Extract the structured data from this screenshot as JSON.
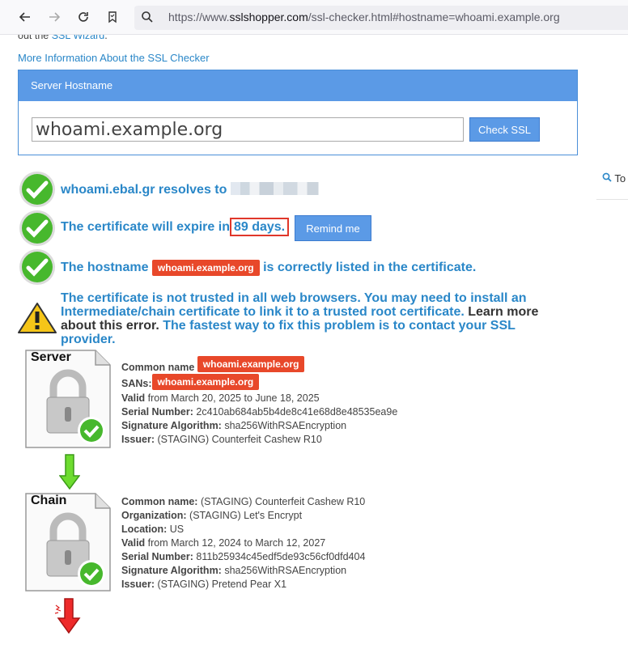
{
  "browser": {
    "url_prefix": "https://www.",
    "url_host": "sslshopper.com",
    "url_path": "/ssl-checker.html#hostname=whoami.example.org",
    "icons": [
      "back-arrow-icon",
      "forward-arrow-icon",
      "reload-icon",
      "bookmark-icon",
      "search-icon"
    ]
  },
  "page": {
    "cut_text": "out the",
    "ssl_wizard_link": "SSL Wizard",
    "cut_period": ".",
    "more_info_link": "More Information About the SSL Checker",
    "form": {
      "heading": "Server Hostname",
      "hostname_value": "whoami.example.org",
      "check_button": "Check SSL"
    },
    "results": {
      "resolves_text": "whoami.ebal.gr resolves to",
      "expire_prefix": "The certificate will expire in",
      "expire_days": "89 days.",
      "remind_button": "Remind me",
      "hostname_prefix": "The hostname",
      "hostname_redacted": "whoami.example.org",
      "hostname_suffix": "is correctly listed in the certificate.",
      "warning_part1": "The certificate is not trusted in all web browsers. You may need to install an Intermediate/chain certificate to link it to a trusted root certificate.",
      "warning_part2": "Learn more about this error.",
      "warning_part3": "The fastest way to fix this problem is to contact your SSL provider."
    },
    "server_cert": {
      "label": "Server",
      "common_name_label": "Common name",
      "common_name": "whoami.example.org",
      "sans_label": "SANs:",
      "sans": "whoami.example.org",
      "valid_label": "Valid",
      "valid_text": "from March 20, 2025 to June 18, 2025",
      "serial_label": "Serial Number:",
      "serial": "2c410ab684ab5b4de8c41e68d8e48535ea9e",
      "sigalg_label": "Signature Algorithm:",
      "sigalg": "sha256WithRSAEncryption",
      "issuer_label": "Issuer:",
      "issuer": "(STAGING) Counterfeit Cashew R10"
    },
    "chain_cert": {
      "label": "Chain",
      "common_name_label": "Common name:",
      "common_name": "(STAGING) Counterfeit Cashew R10",
      "org_label": "Organization:",
      "org": "(STAGING) Let's Encrypt",
      "location_label": "Location:",
      "location": "US",
      "valid_label": "Valid",
      "valid_text": "from March 12, 2024 to March 12, 2027",
      "serial_label": "Serial Number:",
      "serial": "811b25934c45edf5de93c56cf0dfd404",
      "sigalg_label": "Signature Algorithm:",
      "sigalg": "sha256WithRSAEncryption",
      "issuer_label": "Issuer:",
      "issuer": "(STAGING) Pretend Pear X1"
    },
    "sidebar": {
      "search_label": "To"
    },
    "colors": {
      "link": "#2a87c8",
      "button": "#5b9ae6",
      "redact": "#e8482a",
      "ok_green": "#47b82d"
    }
  }
}
